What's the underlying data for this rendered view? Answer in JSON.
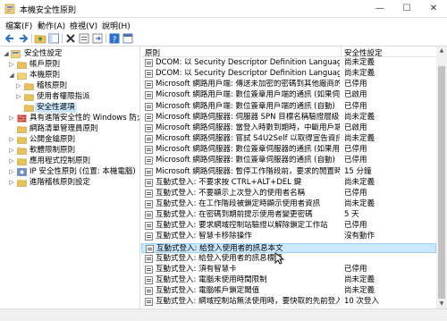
{
  "window": {
    "title": "本機安全性原則",
    "minimize_glyph": "—",
    "maximize_glyph": "☐",
    "close_glyph": "✕"
  },
  "menu": [
    "檔案(F)",
    "動作(A)",
    "檢視(V)",
    "說明(H)"
  ],
  "toolbar_icons": [
    "back-arrow-icon",
    "forward-arrow-icon",
    "up-folder-icon",
    "show-tree-icon",
    "delete-icon",
    "properties-icon",
    "refresh-icon",
    "export-list-icon",
    "help-icon",
    "mmc-icon"
  ],
  "tree": [
    {
      "label": "安全性設定",
      "expanded": true,
      "selected": false
    },
    {
      "label": "帳戶原則",
      "expanded": false,
      "selected": false
    },
    {
      "label": "本機原則",
      "expanded": true,
      "selected": false
    },
    {
      "label": "稽核原則",
      "expanded": false,
      "selected": false
    },
    {
      "label": "使用者權限指派",
      "expanded": false,
      "selected": false
    },
    {
      "label": "安全性選項",
      "expanded": false,
      "selected": true
    },
    {
      "label": "具有進階安全性的 Windows 防火牆",
      "expanded": false,
      "selected": false
    },
    {
      "label": "網路清單管理員原則",
      "expanded": false,
      "selected": false
    },
    {
      "label": "公開金鑰原則",
      "expanded": false,
      "selected": false
    },
    {
      "label": "軟體限制原則",
      "expanded": false,
      "selected": false
    },
    {
      "label": "應用程式控制原則",
      "expanded": false,
      "selected": false
    },
    {
      "label": "IP 安全性原則 (位置: 本機電腦)",
      "expanded": false,
      "selected": false
    },
    {
      "label": "進階稽核原則設定",
      "expanded": false,
      "selected": false
    }
  ],
  "list": {
    "headers": {
      "policy": "原則",
      "setting": "安全性設定"
    },
    "rows": [
      {
        "name": "DCOM: 以 Security Descriptor Definition Language (SDD...",
        "value": "尚未定義"
      },
      {
        "name": "DCOM: 以 Security Descriptor Definition Language (SDD...",
        "value": "尚未定義"
      },
      {
        "name": "Microsoft 網路用戶端: 傳送未加密的密碼到其他廠商的 SM...",
        "value": "已停用"
      },
      {
        "name": "Microsoft 網路用戶端: 數位簽章用戶端的通訊 (如果伺服器...",
        "value": "已啟用"
      },
      {
        "name": "Microsoft 網路用戶端: 數位簽章用戶端的通訊 (自動)",
        "value": "已停用"
      },
      {
        "name": "Microsoft 網路伺服器: 伺服器 SPN 目標名稱驗證層級",
        "value": "尚未定義"
      },
      {
        "name": "Microsoft 網路伺服器: 當登入時數到期時，中斷用戶端連線",
        "value": "已啟用"
      },
      {
        "name": "Microsoft 網路伺服器: 嘗試 S4U2Self 以取得宣告資訊",
        "value": "尚未定義"
      },
      {
        "name": "Microsoft 網路伺服器: 數位簽章伺服器的通訊 (如果用戶端...",
        "value": "已停用"
      },
      {
        "name": "Microsoft 網路伺服器: 數位簽章伺服器的通訊 (自動)",
        "value": "已停用"
      },
      {
        "name": "Microsoft 網路伺服器: 暫停工作階段前，要求的閒置時間",
        "value": "15 分鐘"
      },
      {
        "name": "互動式登入: 不要求按 CTRL+ALT+DEL 鍵",
        "value": "尚未定義"
      },
      {
        "name": "互動式登入: 不要顯示上次登入的使用者名稱",
        "value": "已停用"
      },
      {
        "name": "互動式登入: 在工作階段被鎖定時顯示使用者資訊",
        "value": "尚未定義"
      },
      {
        "name": "互動式登入: 在密碼到期前提示使用者變更密碼",
        "value": "5 天"
      },
      {
        "name": "互動式登入: 要求網域控制站驗證以解除鎖定工作站",
        "value": "已停用"
      },
      {
        "name": "互動式登入: 智慧卡移除操作",
        "value": "沒有動作"
      },
      {
        "name": "互動式登入: 給登入使用者的訊息本文",
        "value": ""
      },
      {
        "name": "互動式登入: 給登入使用者的訊息標題",
        "value": ""
      },
      {
        "name": "互動式登入: 須有智慧卡",
        "value": "已停用"
      },
      {
        "name": "互動式登入: 電腦未使用時間限制",
        "value": "尚未定義"
      },
      {
        "name": "互動式登入: 電腦帳戶鎖定閾值",
        "value": "尚未定義"
      },
      {
        "name": "互動式登入: 網域控制站無法使用時，要快取的先前登入次數",
        "value": "10 次登入"
      }
    ],
    "selected_index": 17
  },
  "scrollbar": {
    "up_glyph": "▲",
    "down_glyph": "▼"
  }
}
